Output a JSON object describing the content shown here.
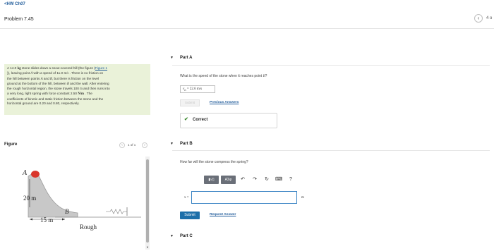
{
  "header": {
    "back_link": "<HW Ch07",
    "title": "Problem 7.45",
    "nav_prev": "‹",
    "page_indicator": "4 o"
  },
  "problem": {
    "line1a": "A 14.0 ",
    "line1_unit": "kg",
    "line1b": " stone slides down a snow-covered hill (the figure (",
    "line1_link": "Figure 1",
    "line2a": ")), leaving point ",
    "point_a": "A",
    "line2b": " with a speed of 11.0 ",
    "speed_unit": "m/s",
    "line2c": " . There is no friction on",
    "line3": "the hill between points ",
    "point_a2": "A",
    "and_text": " and ",
    "point_b": "B",
    "line3b": ", but there is friction on the level",
    "line4a": "ground at the bottom of the hill, between ",
    "point_b2": "B",
    "line4b": " and the wall. After entering",
    "line5a": "the rough horizontal region, the stone travels 100 ",
    "dist_unit": "m",
    "line5b": " and then runs into",
    "line6a": "a very long, light spring with force constant 2.50 ",
    "k_unit": "N/m",
    "line6b": " . The",
    "line7": "coefficients of kinetic and static friction between the stone and the",
    "line8": "horizontal ground are 0.20 and 0.80, respectively."
  },
  "figure": {
    "label": "Figure",
    "prev": "‹",
    "count": "1 of 1",
    "next": "›",
    "label_a": "A",
    "label_height": "20 m",
    "label_b": "B",
    "label_width": "15 m",
    "label_rough": "Rough",
    "stone_color": "#d9352b",
    "hill_color": "#c8c8c8"
  },
  "scrollbar": {
    "down_arrow": "▼"
  },
  "part_a": {
    "caret": "▼",
    "title": "Part A",
    "question_prefix": "What is the speed of the stone when it reaches point ",
    "question_point": "B",
    "question_suffix": "?",
    "answer_var": "v",
    "answer_sub": "B",
    "answer_value": " = 22.6 ",
    "answer_unit": "m/s",
    "submit_label": "Submit",
    "previous_answers": "Previous Answers",
    "check": "✔",
    "status": "Correct"
  },
  "part_b": {
    "caret": "▼",
    "title": "Part B",
    "question": "How far will the stone compress the spring?",
    "toolbar": {
      "templates_label": "▮√▯",
      "greek_label": "ΑΣφ",
      "undo_icon": "↶",
      "redo_icon": "↷",
      "reset_icon": "↻",
      "keyboard_icon": "⌨",
      "help_icon": "?"
    },
    "input_prefix": "x =",
    "input_value": "",
    "unit": "m",
    "submit_label": "Submit",
    "request_answer": "Request Answer"
  },
  "part_c": {
    "caret": "▼",
    "title": "Part C"
  },
  "colors": {
    "link": "#1f5b9a",
    "problem_bg": "#eaf2d9",
    "submit": "#1d6fa9",
    "correct": "#3c8a2e"
  }
}
